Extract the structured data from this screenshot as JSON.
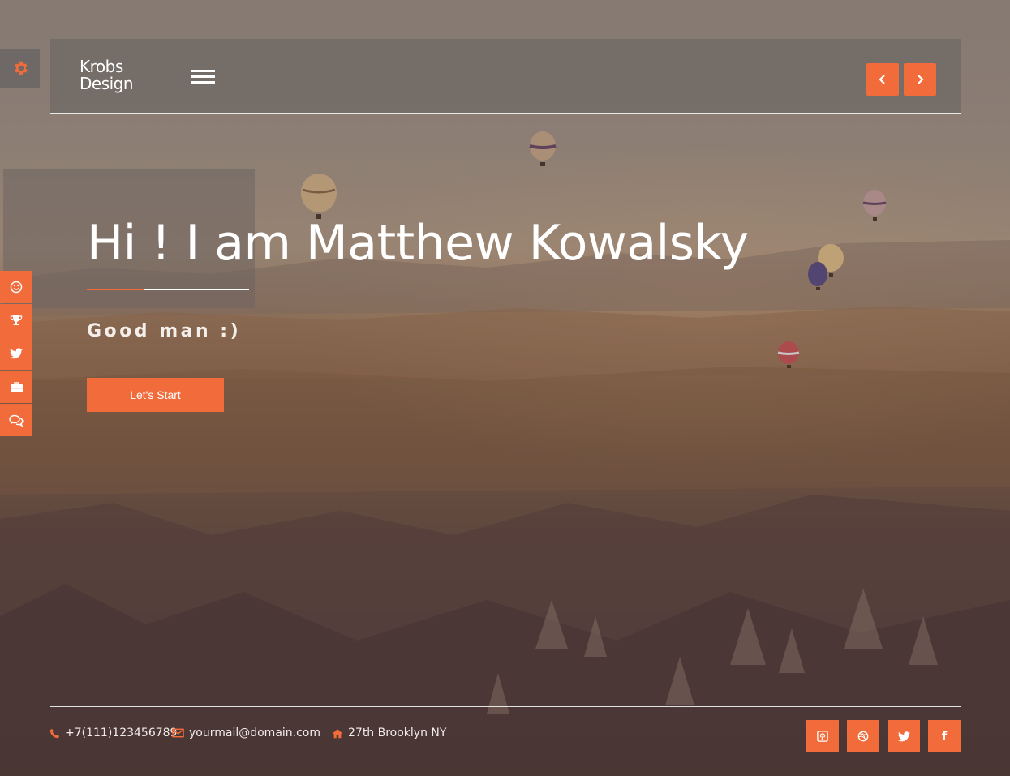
{
  "brand": {
    "logo_line1": "Krobs",
    "logo_line2": "Design"
  },
  "hero": {
    "title": "Hi ! I am Matthew Kowalsky",
    "subtitle": "Good man :)",
    "cta_label": "Let's Start"
  },
  "side_menu": {
    "items": [
      {
        "icon": "smile-icon"
      },
      {
        "icon": "trophy-icon"
      },
      {
        "icon": "twitter-icon"
      },
      {
        "icon": "briefcase-icon"
      },
      {
        "icon": "chat-icon"
      }
    ]
  },
  "footer": {
    "phone": "+7(111)123456789",
    "email": "yourmail@domain.com",
    "address": "27th Brooklyn NY",
    "social": [
      {
        "icon": "pinterest-icon"
      },
      {
        "icon": "dribbble-icon"
      },
      {
        "icon": "twitter-icon"
      },
      {
        "icon": "facebook-icon",
        "glyph": "f"
      }
    ]
  },
  "colors": {
    "accent": "#f26b3a",
    "header_bg": "#6e6864",
    "text": "#ffffff"
  }
}
